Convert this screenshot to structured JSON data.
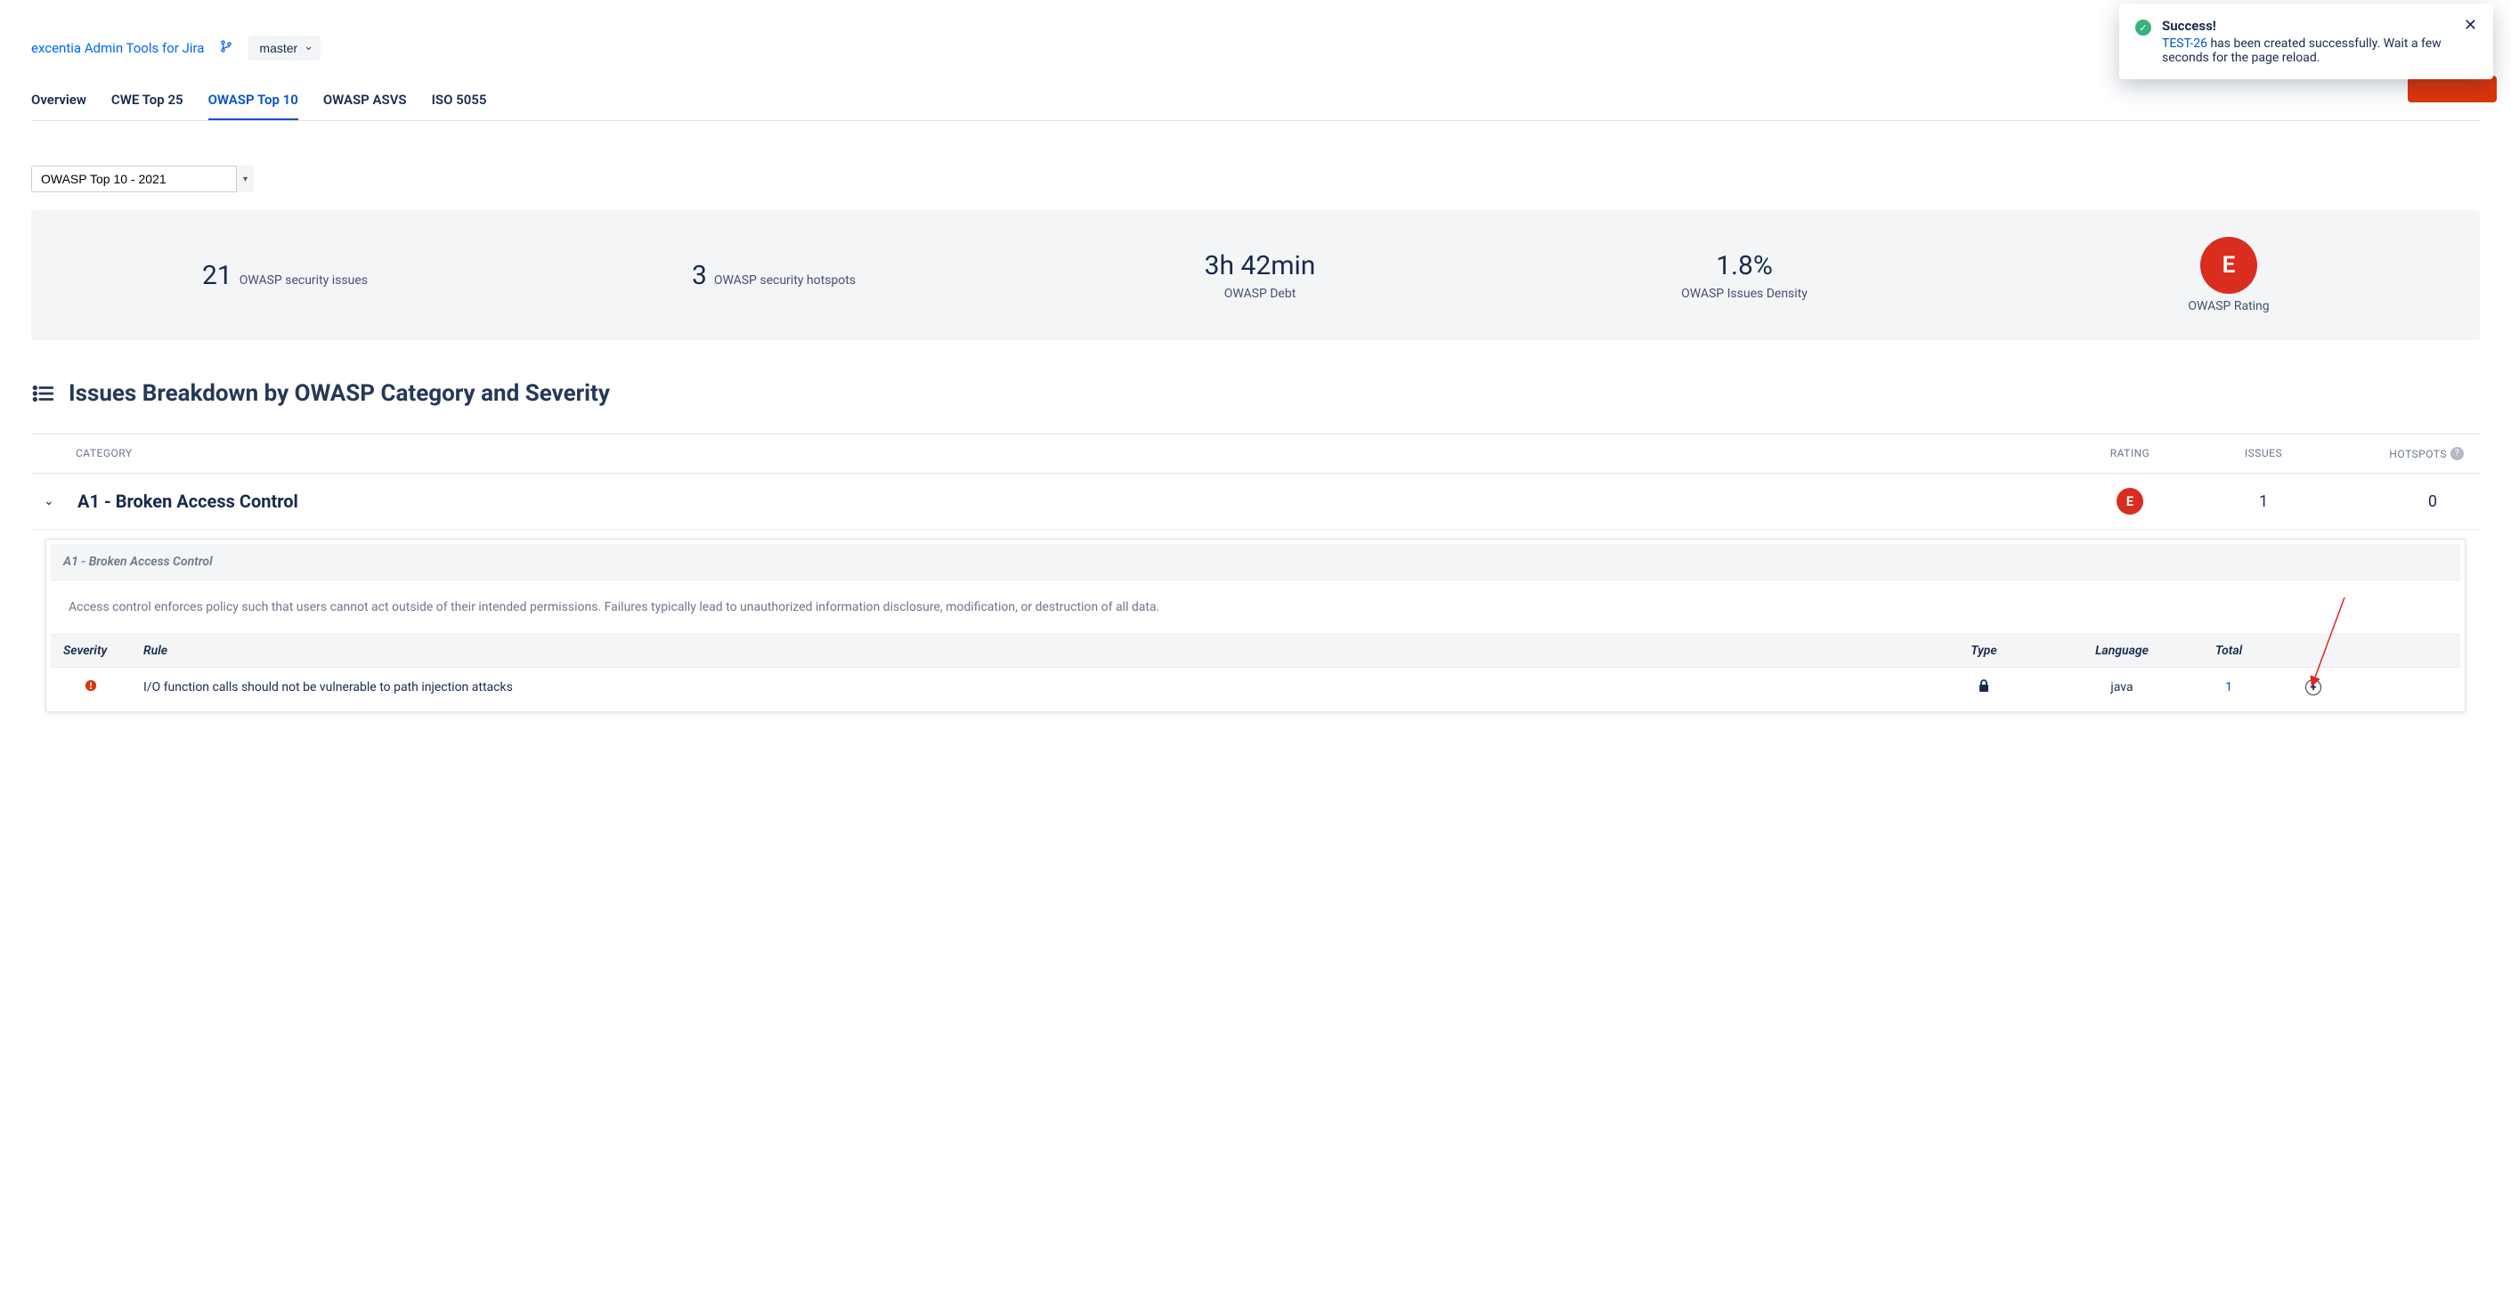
{
  "toast": {
    "title": "Success!",
    "issue_key": "TEST-26",
    "message_suffix": " has been created successfully. Wait a few seconds for the page reload."
  },
  "breadcrumb": {
    "project_link": "excentia Admin Tools for Jira",
    "branch": "master"
  },
  "tabs": [
    {
      "label": "Overview",
      "active": false
    },
    {
      "label": "CWE Top 25",
      "active": false
    },
    {
      "label": "OWASP Top 10",
      "active": true
    },
    {
      "label": "OWASP ASVS",
      "active": false
    },
    {
      "label": "ISO 5055",
      "active": false
    }
  ],
  "version_select": "OWASP Top 10 - 2021",
  "summary": {
    "issues": {
      "value": "21",
      "label": "OWASP security issues"
    },
    "hotspots": {
      "value": "3",
      "label": "OWASP security hotspots"
    },
    "debt": {
      "value": "3h 42min",
      "label": "OWASP Debt"
    },
    "density": {
      "value": "1.8%",
      "label": "OWASP Issues Density"
    },
    "rating": {
      "value": "E",
      "label": "OWASP Rating"
    }
  },
  "section_title": "Issues Breakdown by OWASP Category and Severity",
  "columns": {
    "category": "CATEGORY",
    "rating": "RATING",
    "issues": "ISSUES",
    "hotspots": "HOTSPOTS"
  },
  "category": {
    "name": "A1 - Broken Access Control",
    "rating": "E",
    "issues": "1",
    "hotspots": "0"
  },
  "detail": {
    "title": "A1 - Broken Access Control",
    "description": "Access control enforces policy such that users cannot act outside of their intended permissions. Failures typically lead to unauthorized information disclosure, modification, or destruction of all data.",
    "table": {
      "headers": {
        "severity": "Severity",
        "rule": "Rule",
        "type": "Type",
        "language": "Language",
        "total": "Total"
      },
      "row": {
        "severity_icon": "critical",
        "rule": "I/O function calls should not be vulnerable to path injection attacks",
        "type_icon": "lock",
        "language": "java",
        "total": "1"
      }
    }
  }
}
